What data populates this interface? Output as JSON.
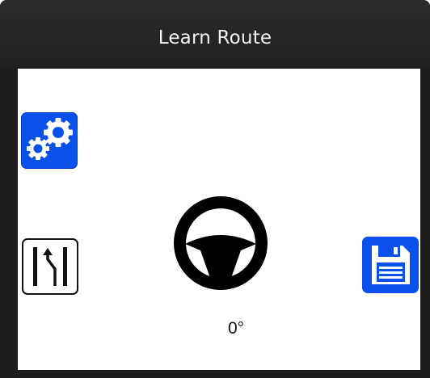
{
  "window": {
    "title": "Learn Route"
  },
  "controls": {
    "settings_icon": "gears-icon",
    "lane_icon": "lane-change-icon",
    "save_icon": "floppy-disk-icon",
    "wheel_icon": "steering-wheel-icon"
  },
  "steering": {
    "angle": "0°"
  },
  "colors": {
    "titlebar": "#1f1f1f",
    "accent": "#0a50ea",
    "canvas": "#ffffff"
  }
}
